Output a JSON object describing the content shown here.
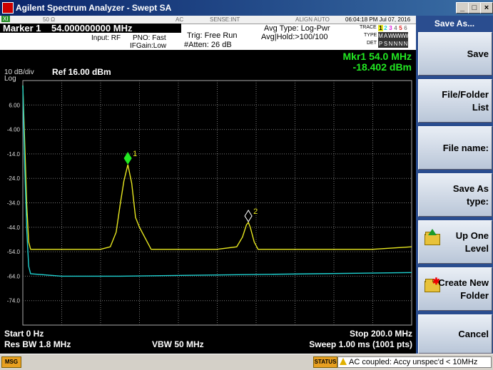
{
  "window": {
    "title": "Agilent Spectrum Analyzer - Swept SA",
    "min": "_",
    "max": "□",
    "close": "×"
  },
  "header_row": {
    "xi": "XI",
    "impedance": "50 Ω",
    "coupling": "AC",
    "sense": "SENSE:INT",
    "align": "ALIGN AUTO",
    "datetime": "06:04:18 PM Jul 07, 2016"
  },
  "marker_line": {
    "label": "Marker 1",
    "freq": "54.000000000 MHz"
  },
  "settings": {
    "input": "Input: RF",
    "pno": "PNO: Fast",
    "ifgain": "IFGain:Low",
    "trig": "Trig: Free Run",
    "atten": "#Atten: 26 dB",
    "avg_type": "Avg Type: Log-Pwr",
    "avg_hold": "Avg|Hold:>100/100",
    "trace_lbl": "TRACE",
    "type_lbl": "TYPE",
    "det_lbl": "DET",
    "trace_digits": [
      "1",
      "2",
      "3",
      "4",
      "5",
      "6"
    ],
    "type_letters": [
      "M",
      "A",
      "W",
      "W",
      "W",
      "W"
    ],
    "det_letters": [
      "P",
      "S",
      "N",
      "N",
      "N",
      "N"
    ]
  },
  "softkeys": {
    "title": "Save As...",
    "items": [
      {
        "lines": [
          "Save"
        ],
        "icon": ""
      },
      {
        "lines": [
          "File/Folder",
          "List"
        ],
        "icon": ""
      },
      {
        "lines": [
          "File name:"
        ],
        "icon": ""
      },
      {
        "lines": [
          "Save As",
          "type:"
        ],
        "icon": ""
      },
      {
        "lines": [
          "Up One",
          "Level"
        ],
        "icon": "folder-up-icon"
      },
      {
        "lines": [
          "Create New",
          "Folder"
        ],
        "icon": "new-folder-icon"
      },
      {
        "lines": [
          "Cancel"
        ],
        "icon": ""
      }
    ]
  },
  "display": {
    "marker_readout_1": "Mkr1 54.0 MHz",
    "marker_readout_2": "-18.402 dBm",
    "scale": "10 dB/div",
    "log": "Log",
    "ref": "Ref 16.00 dBm",
    "start": "Start 0 Hz",
    "stop": "Stop 200.0 MHz",
    "rbw": "Res BW 1.8 MHz",
    "vbw": "VBW 50 MHz",
    "sweep": "Sweep  1.00 ms (1001 pts)",
    "marker1_label": "1",
    "marker2_label": "2"
  },
  "chart_data": {
    "type": "line",
    "xlim": [
      0,
      200
    ],
    "ylim": [
      -84,
      16
    ],
    "y_ticks": [
      "6.00",
      "-4.00",
      "-14.0",
      "-24.0",
      "-34.0",
      "-44.0",
      "-54.0",
      "-64.0",
      "-74.0"
    ],
    "grid": true,
    "series": [
      {
        "color": "#e8e820",
        "points": [
          [
            0,
            14
          ],
          [
            1,
            -10
          ],
          [
            2,
            -35
          ],
          [
            3,
            -50
          ],
          [
            4,
            -53
          ],
          [
            10,
            -53
          ],
          [
            20,
            -53
          ],
          [
            30,
            -53
          ],
          [
            40,
            -53
          ],
          [
            45,
            -52
          ],
          [
            48,
            -46
          ],
          [
            50,
            -35
          ],
          [
            52,
            -25
          ],
          [
            54,
            -18.4
          ],
          [
            56,
            -26
          ],
          [
            58,
            -40
          ],
          [
            60,
            -44
          ],
          [
            62,
            -47
          ],
          [
            64,
            -50
          ],
          [
            66,
            -53
          ],
          [
            80,
            -53
          ],
          [
            100,
            -53
          ],
          [
            110,
            -52
          ],
          [
            113,
            -48
          ],
          [
            115,
            -43
          ],
          [
            116,
            -42
          ],
          [
            117,
            -44
          ],
          [
            119,
            -50
          ],
          [
            121,
            -53
          ],
          [
            140,
            -53
          ],
          [
            160,
            -53
          ],
          [
            180,
            -53
          ],
          [
            200,
            -52
          ]
        ]
      },
      {
        "color": "#1ecfcf",
        "points": [
          [
            0,
            14
          ],
          [
            1,
            -20
          ],
          [
            2,
            -45
          ],
          [
            3,
            -60
          ],
          [
            4,
            -63
          ],
          [
            20,
            -64
          ],
          [
            50,
            -64
          ],
          [
            100,
            -63.5
          ],
          [
            150,
            -63
          ],
          [
            200,
            -62.5
          ]
        ]
      }
    ],
    "markers": [
      {
        "label": "1",
        "x": 54,
        "y": -18.4,
        "style": "filled",
        "color": "#22e822"
      },
      {
        "label": "2",
        "x": 116,
        "y": -42,
        "style": "outline",
        "color": "#ffffff"
      }
    ]
  },
  "status": {
    "msg": "MSG",
    "status": "STATUS",
    "message": "AC coupled: Accy unspec'd < 10MHz"
  }
}
